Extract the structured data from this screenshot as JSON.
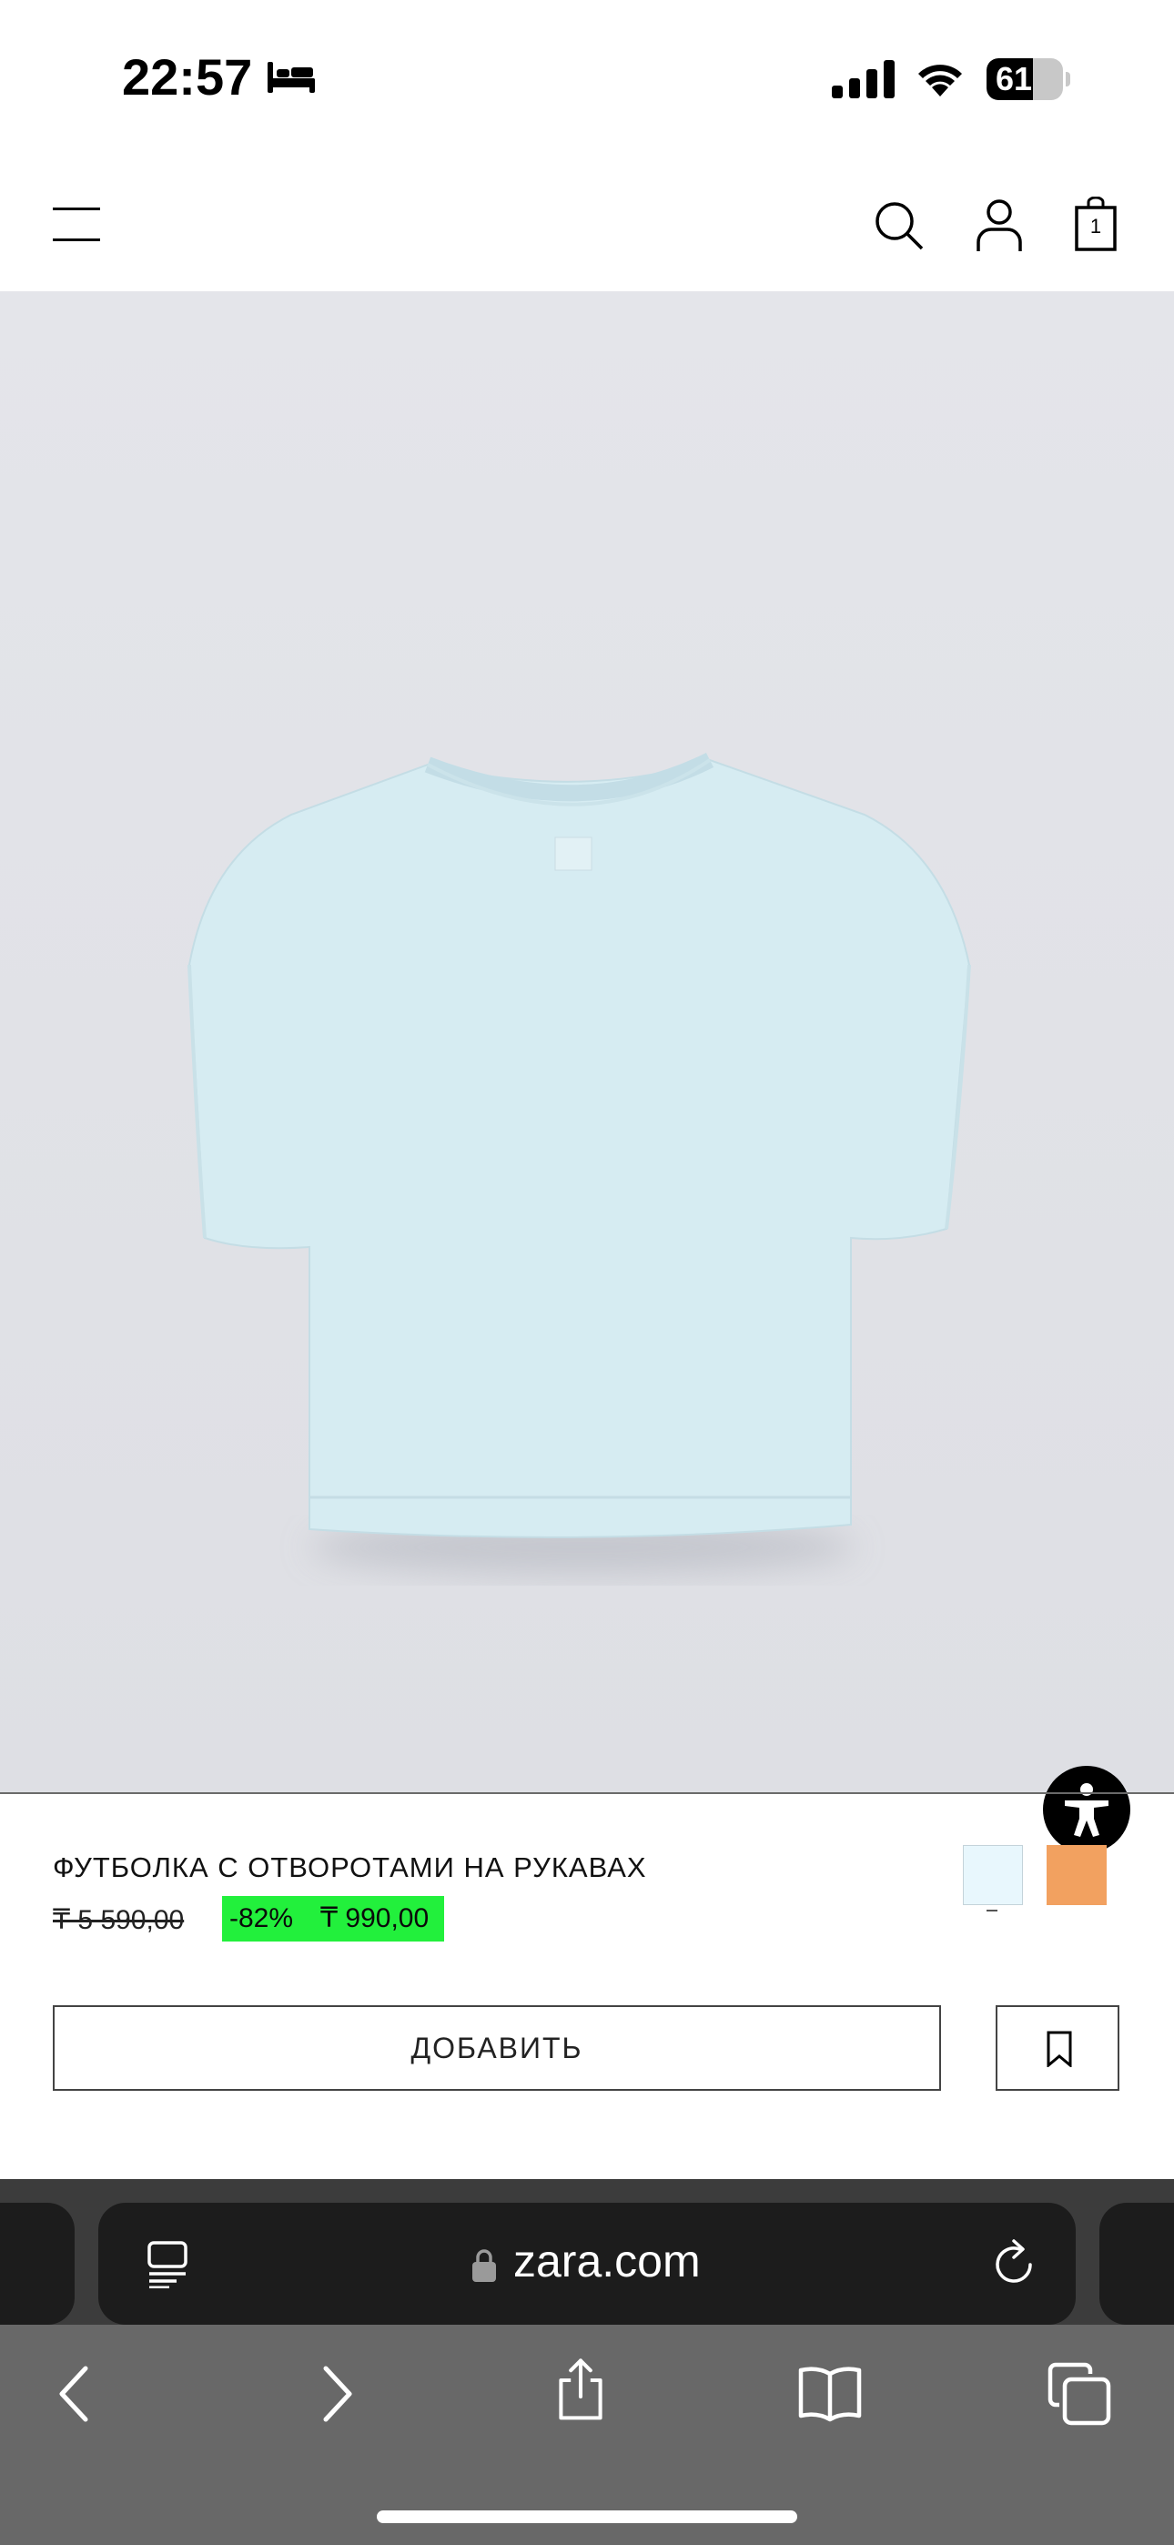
{
  "status_bar": {
    "time": "22:57",
    "battery_percent": "61",
    "battery_level": 0.61,
    "icons": [
      "bed-icon",
      "cellular-signal-icon",
      "wifi-icon",
      "battery-icon"
    ]
  },
  "header": {
    "icons": [
      "menu-icon",
      "search-icon",
      "account-icon",
      "shopping-bag-icon"
    ],
    "bag_count": "1"
  },
  "product": {
    "title": "ФУТБОЛКА С ОТВОРОТАМИ НА РУКАВАХ",
    "old_price": "₸ 5 590,00",
    "discount": "-82%",
    "new_price": "₸ 990,00",
    "sale_color": "#22f03c",
    "colors": [
      {
        "name": "light-blue",
        "hex": "#e8f7fd",
        "selected": true
      },
      {
        "name": "orange",
        "hex": "#f2a160",
        "selected": false
      }
    ],
    "add_label": "ДОБАВИТЬ",
    "garment_color": "#d6ecf2"
  },
  "accessibility": {
    "icon": "accessibility-icon"
  },
  "safari": {
    "url": "zara.com",
    "toolbar_icons": [
      "back-icon",
      "forward-icon",
      "share-icon",
      "bookmarks-icon",
      "tabs-icon"
    ]
  }
}
